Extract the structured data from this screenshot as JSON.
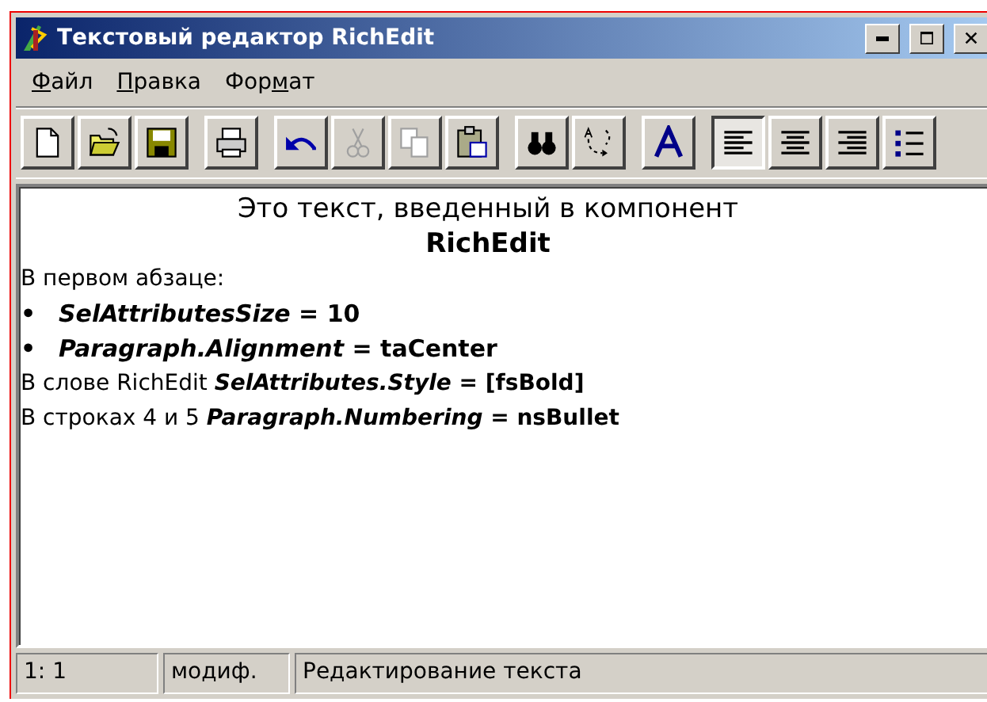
{
  "window": {
    "title": "Текстовый редактор RichEdit"
  },
  "menu": [
    {
      "key": "Ф",
      "after": "айл"
    },
    {
      "key": "П",
      "after": "равка"
    },
    {
      "before": "Фор",
      "key": "м",
      "after": "ат"
    }
  ],
  "toolbar": [
    [
      {
        "kind": "new",
        "disabled": false,
        "pressed": false
      },
      {
        "kind": "open",
        "disabled": false,
        "pressed": false
      },
      {
        "kind": "save",
        "disabled": false,
        "pressed": false
      }
    ],
    [
      {
        "kind": "print",
        "disabled": false,
        "pressed": false
      }
    ],
    [
      {
        "kind": "undo",
        "disabled": false,
        "pressed": false
      },
      {
        "kind": "cut",
        "disabled": true,
        "pressed": false
      },
      {
        "kind": "copy",
        "disabled": true,
        "pressed": false
      },
      {
        "kind": "paste",
        "disabled": false,
        "pressed": false
      }
    ],
    [
      {
        "kind": "find",
        "disabled": false,
        "pressed": false
      },
      {
        "kind": "replace",
        "disabled": false,
        "pressed": false
      }
    ],
    [
      {
        "kind": "font",
        "disabled": false,
        "pressed": false
      }
    ],
    [
      {
        "kind": "left",
        "disabled": false,
        "pressed": true
      },
      {
        "kind": "center",
        "disabled": false,
        "pressed": false
      },
      {
        "kind": "right",
        "disabled": false,
        "pressed": false
      },
      {
        "kind": "bullets",
        "disabled": false,
        "pressed": false
      }
    ]
  ],
  "document": [
    {
      "kind": "caption",
      "text": "Это текст, введенный в компонент"
    },
    {
      "kind": "name",
      "text": "RichEdit"
    },
    {
      "kind": "text",
      "text": "В первом абзаце:"
    },
    {
      "kind": "bullet",
      "marker": "•",
      "text": "***SelAttributesSize* = 10**"
    },
    {
      "kind": "bullet",
      "marker": "•",
      "text": "***Paragraph.Alignment* = taCenter**"
    },
    {
      "kind": "text",
      "text": "В слове RichEdit ***SelAttributes.Style* = [fsBold]**"
    },
    {
      "kind": "text",
      "text": "В строках 4 и 5 ***Paragraph.Numbering* = nsBullet**"
    }
  ],
  "status_bar": [
    "1: 1",
    "модиф.",
    "Редактирование текста"
  ]
}
